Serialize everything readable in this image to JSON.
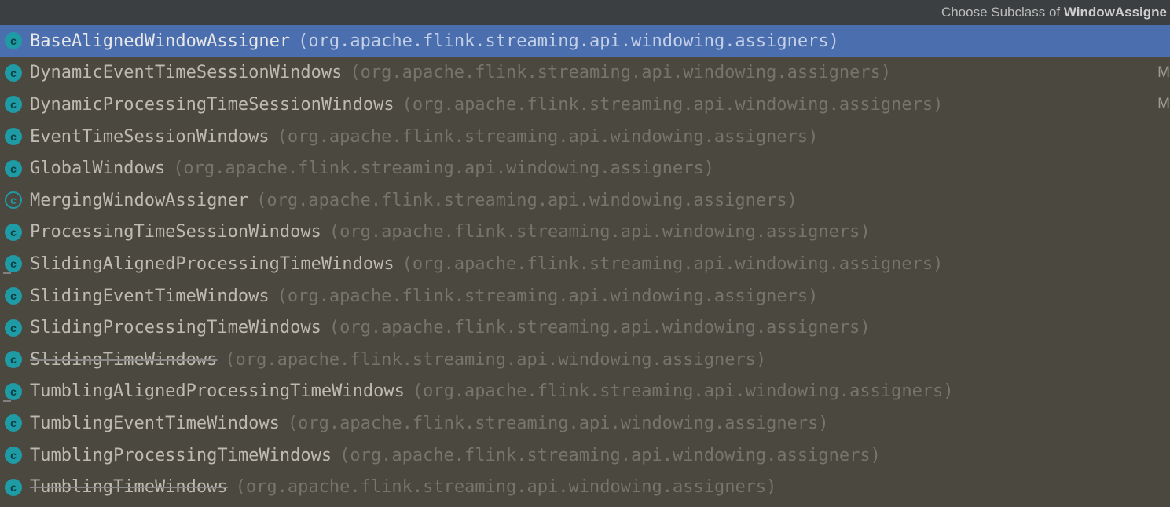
{
  "titlebar": {
    "prefix": "Choose Subclass of ",
    "bold": "WindowAssigne"
  },
  "items": [
    {
      "icon": "class",
      "name": "BaseAlignedWindowAssigner",
      "pkg": "(org.apache.flink.streaming.api.windowing.assigners)",
      "selected": true,
      "strike": false,
      "deprecated": false,
      "trail": ""
    },
    {
      "icon": "class",
      "name": "DynamicEventTimeSessionWindows",
      "pkg": "(org.apache.flink.streaming.api.windowing.assigners)",
      "selected": false,
      "strike": false,
      "deprecated": false,
      "trail": "M"
    },
    {
      "icon": "class",
      "name": "DynamicProcessingTimeSessionWindows",
      "pkg": "(org.apache.flink.streaming.api.windowing.assigners)",
      "selected": false,
      "strike": false,
      "deprecated": false,
      "trail": "M"
    },
    {
      "icon": "class",
      "name": "EventTimeSessionWindows",
      "pkg": "(org.apache.flink.streaming.api.windowing.assigners)",
      "selected": false,
      "strike": false,
      "deprecated": false,
      "trail": ""
    },
    {
      "icon": "class",
      "name": "GlobalWindows",
      "pkg": "(org.apache.flink.streaming.api.windowing.assigners)",
      "selected": false,
      "strike": false,
      "deprecated": false,
      "trail": ""
    },
    {
      "icon": "abstract",
      "name": "MergingWindowAssigner",
      "pkg": "(org.apache.flink.streaming.api.windowing.assigners)",
      "selected": false,
      "strike": false,
      "deprecated": false,
      "trail": ""
    },
    {
      "icon": "class",
      "name": "ProcessingTimeSessionWindows",
      "pkg": "(org.apache.flink.streaming.api.windowing.assigners)",
      "selected": false,
      "strike": false,
      "deprecated": false,
      "trail": ""
    },
    {
      "icon": "class",
      "name": "SlidingAlignedProcessingTimeWindows",
      "pkg": "(org.apache.flink.streaming.api.windowing.assigners)",
      "selected": false,
      "strike": false,
      "deprecated": true,
      "trail": ""
    },
    {
      "icon": "class",
      "name": "SlidingEventTimeWindows",
      "pkg": "(org.apache.flink.streaming.api.windowing.assigners)",
      "selected": false,
      "strike": false,
      "deprecated": false,
      "trail": ""
    },
    {
      "icon": "class",
      "name": "SlidingProcessingTimeWindows",
      "pkg": "(org.apache.flink.streaming.api.windowing.assigners)",
      "selected": false,
      "strike": false,
      "deprecated": false,
      "trail": ""
    },
    {
      "icon": "class",
      "name": "SlidingTimeWindows",
      "pkg": "(org.apache.flink.streaming.api.windowing.assigners)",
      "selected": false,
      "strike": true,
      "deprecated": false,
      "trail": ""
    },
    {
      "icon": "class",
      "name": "TumblingAlignedProcessingTimeWindows",
      "pkg": "(org.apache.flink.streaming.api.windowing.assigners)",
      "selected": false,
      "strike": false,
      "deprecated": true,
      "trail": ""
    },
    {
      "icon": "class",
      "name": "TumblingEventTimeWindows",
      "pkg": "(org.apache.flink.streaming.api.windowing.assigners)",
      "selected": false,
      "strike": false,
      "deprecated": false,
      "trail": ""
    },
    {
      "icon": "class",
      "name": "TumblingProcessingTimeWindows",
      "pkg": "(org.apache.flink.streaming.api.windowing.assigners)",
      "selected": false,
      "strike": false,
      "deprecated": false,
      "trail": ""
    },
    {
      "icon": "class",
      "name": "TumblingTimeWindows",
      "pkg": "(org.apache.flink.streaming.api.windowing.assigners)",
      "selected": false,
      "strike": true,
      "deprecated": false,
      "trail": ""
    }
  ]
}
